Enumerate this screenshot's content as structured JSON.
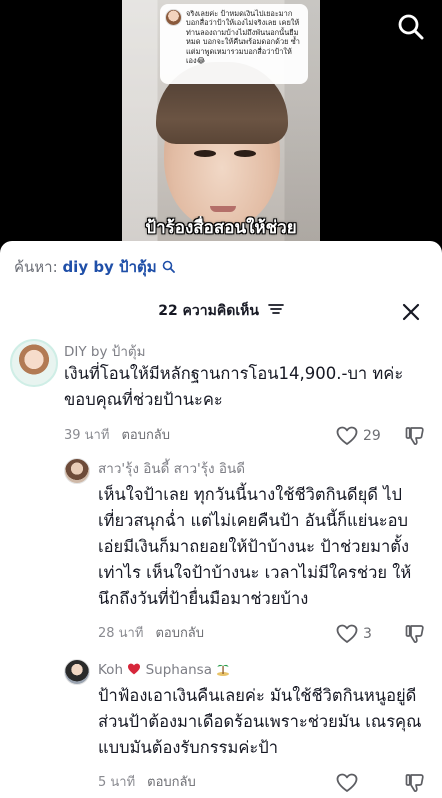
{
  "video": {
    "overlay_comment": "จริงเลยค่ะ ป้าหมดเงินไปเยอะมาก บอกสื่อว่าป้าให้เองไม่จริงเลย เคยให้ท่านลองถามบ้างไม่ถึงพันนอกนั้นยืมหมด บอกจะให้คืนพร้อมดอกด้วย ซ้ำ แต่มาพูดเหมารวมบอกสื่อว่าป้าให้เอง😂",
    "caption": "ป้าร้องสื่อสอนให้ช่วย"
  },
  "search": {
    "label": "ค้นหา:",
    "keyword": "diy by ป้าตุ้ม"
  },
  "header": {
    "title": "22 ความคิดเห็น"
  },
  "comments": [
    {
      "username": "DIY by ป้าตุ้ม",
      "text": "เงินที่โอนให้มีหลักฐานการโอน14,900.-บา ทค่ะ ขอบคุณที่ช่วยป้านะคะ",
      "time": "39 นาที",
      "reply": "ตอบกลับ",
      "likes": "29"
    },
    {
      "username": "สาว'รุ้ง อินดี้ สาว'รุ้ง อินดี",
      "text": "เห็นใจป้าเลย ทุกวันนี้นางใช้ชีวิตกินดียุดี ไปเที่ยวสนุกฉ่ำ แต่ไม่เคยคืนป้า อันนี้ก็แย่นะอบเอ่ยมีเงินก็มาถยอยให้ป้าบ้างนะ ป้าช่วยมาตั้งเท่าไร เห็นใจป้าบ้างนะ เวลาไม่มีใครช่วย ให้นึกถึงวันที่ป้ายื่นมือมาช่วยบ้าง",
      "time": "28 นาที",
      "reply": "ตอบกลับ",
      "likes": "3"
    },
    {
      "username_part1": "Koh",
      "username_part2": "Suphansa",
      "text": "ป้าฟ้องเอาเงินคืนเลยค่ะ มันใช้ชีวิตกินหนูอยู่ดี ส่วนป้าต้องมาเดือดร้อนเพราะช่วยมัน เณรคุณแบบมันต้องรับกรรมค่ะป้า",
      "time": "5 นาที",
      "reply": "ตอบกลับ",
      "likes": ""
    }
  ],
  "colors": {
    "sheet_bg": "#ffffff",
    "search_keyword": "#1f4fa8",
    "muted_text": "#8a8b91",
    "heart_emoji": "#d6263a"
  },
  "icons": [
    "search-icon",
    "sort-icon",
    "close-icon",
    "heart-icon",
    "dislike-icon",
    "heart-emoji-icon",
    "island-emoji-icon"
  ]
}
